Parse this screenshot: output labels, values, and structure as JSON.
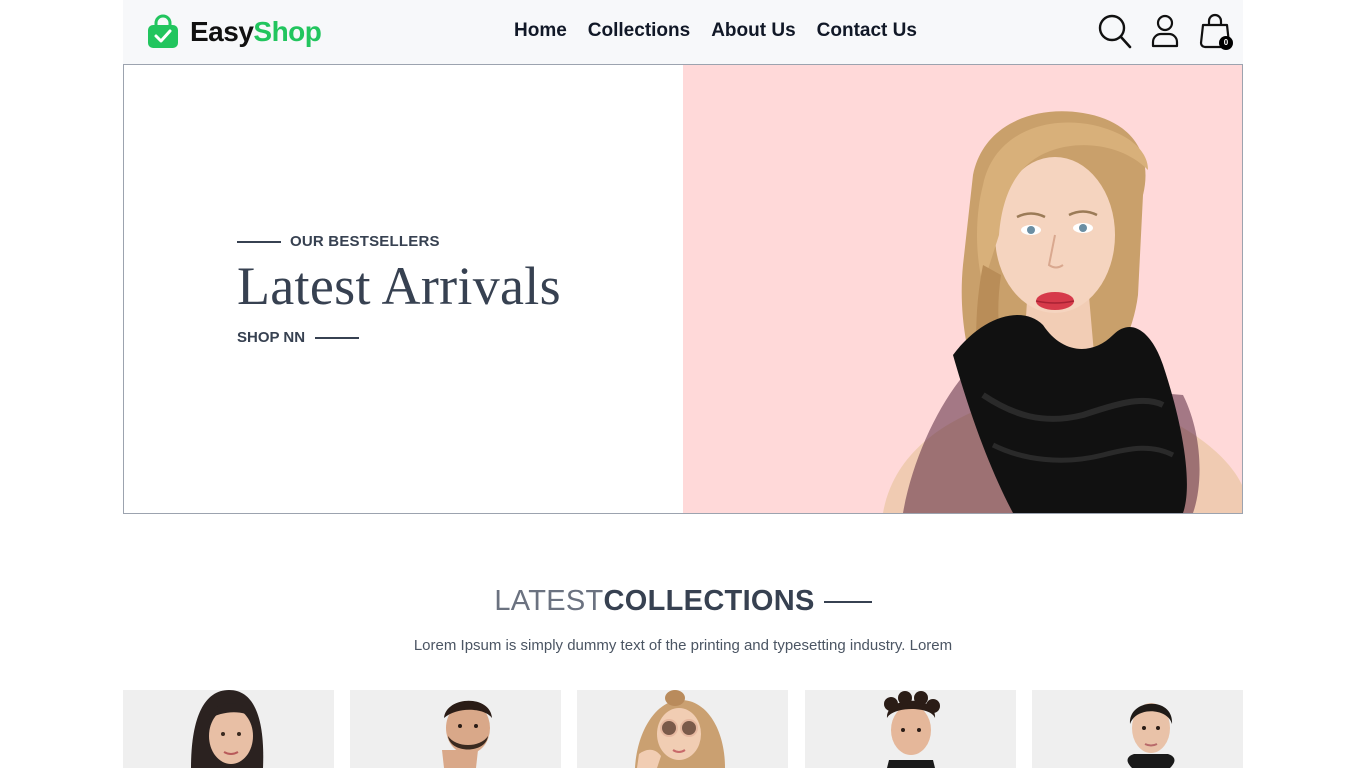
{
  "header": {
    "logo": {
      "icon": "shopping-bag-check-icon",
      "easy": "Easy",
      "shop": "Shop",
      "brand_color": "#22c55e"
    },
    "nav": [
      {
        "label": "Home"
      },
      {
        "label": "Collections"
      },
      {
        "label": "About Us"
      },
      {
        "label": "Contact Us"
      }
    ],
    "icons": [
      "search-icon",
      "user-icon",
      "cart-icon"
    ],
    "cart_count": "0"
  },
  "hero": {
    "kicker": "OUR BESTSELLERS",
    "title": "Latest Arrivals",
    "cta": "SHOP NN",
    "background_color": "#ffd9d9"
  },
  "collections": {
    "title_light": "LATEST",
    "title_bold": "COLLECTIONS",
    "subtitle": "Lorem Ipsum is simply dummy text of the printing and typesetting industry. Lorem",
    "products": [
      {
        "image": "woman-dark-hair-photo"
      },
      {
        "image": "man-beard-photo"
      },
      {
        "image": "girl-sunglasses-photo"
      },
      {
        "image": "man-curly-hair-photo"
      },
      {
        "image": "woman-ponytail-photo"
      }
    ]
  }
}
